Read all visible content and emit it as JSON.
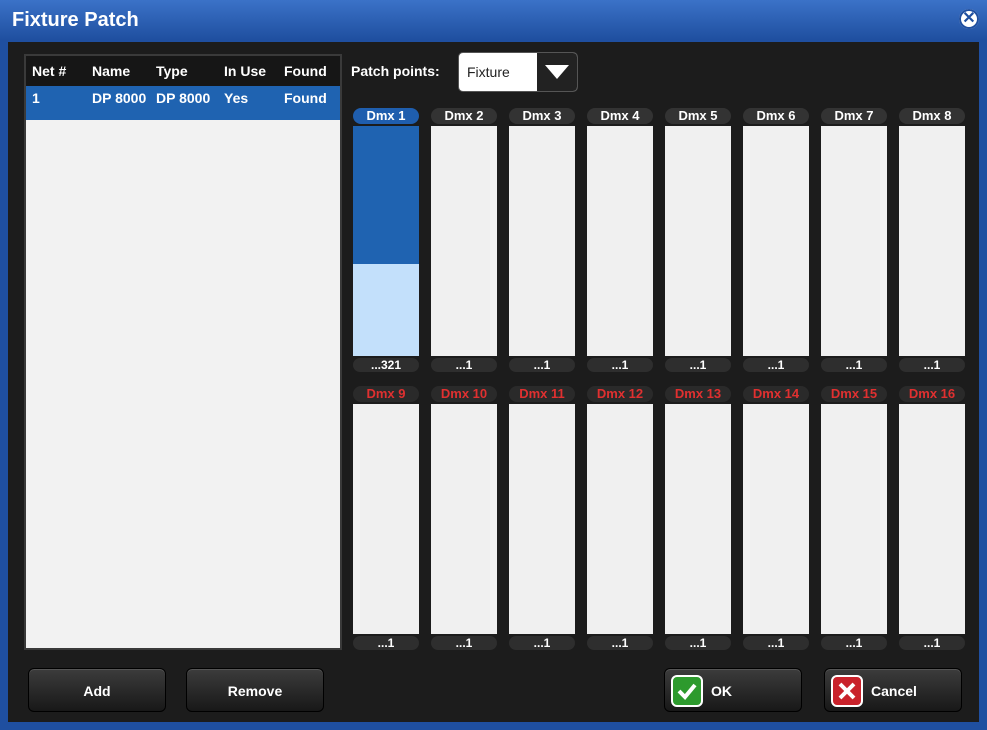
{
  "window": {
    "title": "Fixture Patch",
    "close_icon": "close-circle-icon"
  },
  "list": {
    "columns": [
      "Net #",
      "Name",
      "Type",
      "In Use",
      "Found"
    ],
    "rows": [
      [
        "1",
        "DP 8000",
        "DP 8000",
        "Yes",
        "Found"
      ]
    ]
  },
  "patch": {
    "label": "Patch points:",
    "value": "Fixture"
  },
  "channels_top": [
    {
      "label": "Dmx 1",
      "addr": "...321",
      "active": true
    },
    {
      "label": "Dmx 2",
      "addr": "...1"
    },
    {
      "label": "Dmx 3",
      "addr": "...1"
    },
    {
      "label": "Dmx 4",
      "addr": "...1"
    },
    {
      "label": "Dmx 5",
      "addr": "...1"
    },
    {
      "label": "Dmx 6",
      "addr": "...1"
    },
    {
      "label": "Dmx 7",
      "addr": "...1"
    },
    {
      "label": "Dmx 8",
      "addr": "...1"
    }
  ],
  "channels_bottom": [
    {
      "label": "Dmx 9",
      "addr": "...1"
    },
    {
      "label": "Dmx 10",
      "addr": "...1"
    },
    {
      "label": "Dmx 11",
      "addr": "...1"
    },
    {
      "label": "Dmx 12",
      "addr": "...1"
    },
    {
      "label": "Dmx 13",
      "addr": "...1"
    },
    {
      "label": "Dmx 14",
      "addr": "...1"
    },
    {
      "label": "Dmx 15",
      "addr": "...1"
    },
    {
      "label": "Dmx 16",
      "addr": "...1"
    }
  ],
  "buttons": {
    "add": "Add",
    "remove": "Remove",
    "ok": "OK",
    "cancel": "Cancel"
  },
  "colors": {
    "accent": "#1f63b1",
    "title_bar": "#1f4fa0",
    "inactive_label": "#e03030"
  }
}
